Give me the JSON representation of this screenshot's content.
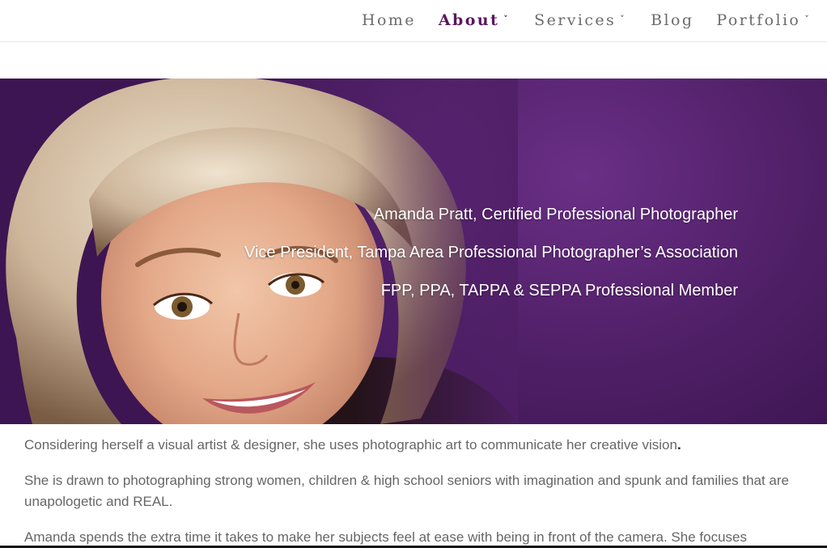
{
  "nav": {
    "items": [
      {
        "label": "Home",
        "has_dropdown": false,
        "active": false
      },
      {
        "label": "About",
        "has_dropdown": true,
        "active": true
      },
      {
        "label": "Services",
        "has_dropdown": true,
        "active": false
      },
      {
        "label": "Blog",
        "has_dropdown": false,
        "active": false
      },
      {
        "label": "Portfolio",
        "has_dropdown": true,
        "active": false
      }
    ],
    "chevron_glyph": "˅"
  },
  "hero": {
    "captions": [
      "Amanda Pratt, Certified Professional Photographer",
      "Vice President, Tampa Area Professional Photographer’s Association",
      "FPP, PPA, TAPPA & SEPPA Professional Member"
    ]
  },
  "content": {
    "paragraph_1": "Considering herself a visual artist & designer, she uses photographic art to communicate her creative vision",
    "paragraph_1_end": ".",
    "paragraph_2": "She is drawn to photographing strong women, children & high school seniors with imagination and spunk and families that are unapologetic and REAL.",
    "paragraph_3": "Amanda spends the extra time it takes to make her subjects feel at ease with being in front of the camera. She focuses"
  },
  "colors": {
    "accent": "#5b1760",
    "nav_text": "#6b6b6b",
    "hero_background": "#4f1f66",
    "body_text": "#666666"
  }
}
